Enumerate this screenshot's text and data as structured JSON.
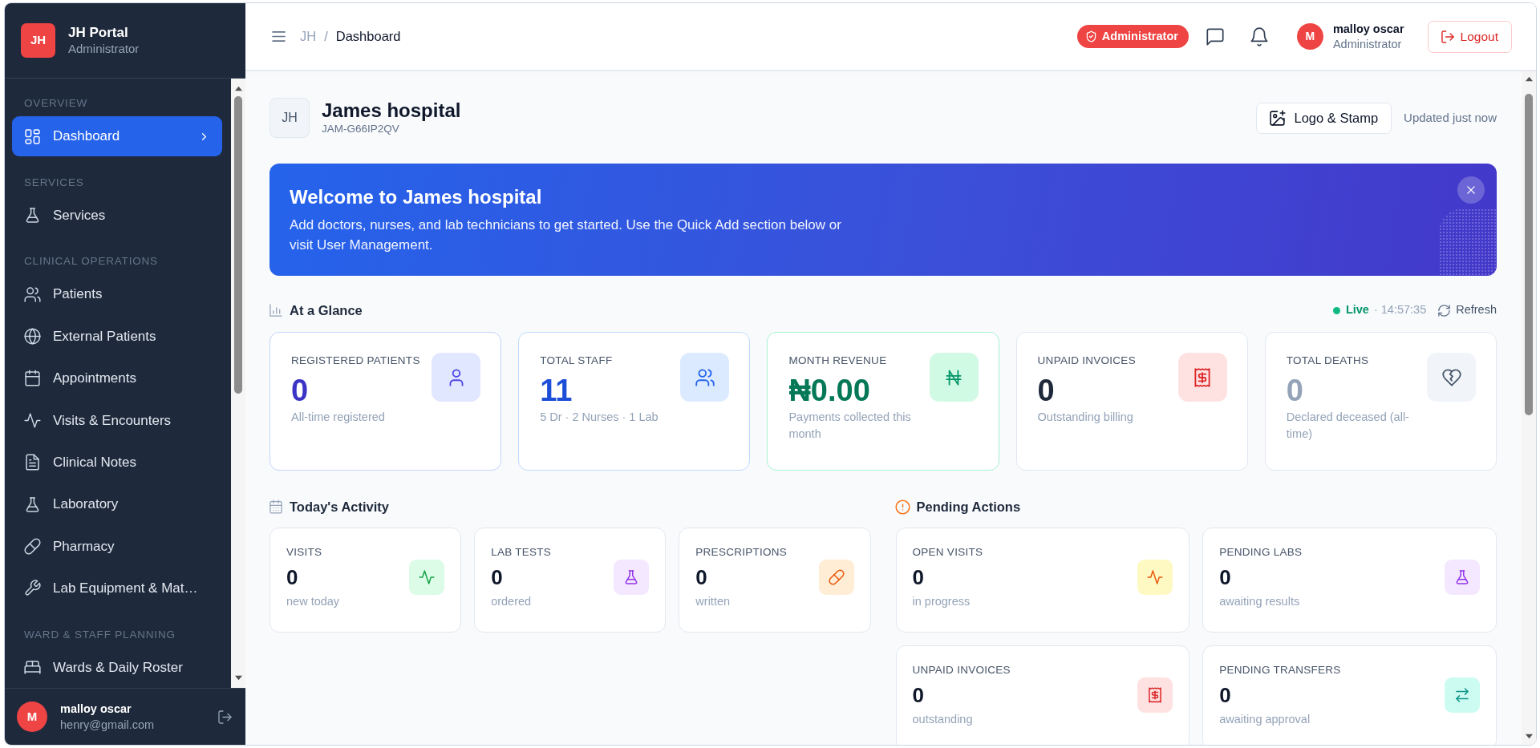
{
  "sidebar": {
    "brand": {
      "logo": "JH",
      "title": "JH Portal",
      "subtitle": "Administrator"
    },
    "sections": [
      {
        "heading": "OVERVIEW",
        "items": [
          {
            "label": "Dashboard",
            "kind": "dashboard",
            "selected": true
          }
        ]
      },
      {
        "heading": "SERVICES",
        "items": [
          {
            "label": "Services",
            "kind": "services",
            "selected": false
          }
        ]
      },
      {
        "heading": "CLINICAL OPERATIONS",
        "items": [
          {
            "label": "Patients",
            "kind": "patients",
            "selected": false
          },
          {
            "label": "External Patients",
            "kind": "external",
            "selected": false
          },
          {
            "label": "Appointments",
            "kind": "appointments",
            "selected": false
          },
          {
            "label": "Visits & Encounters",
            "kind": "visits",
            "selected": false
          },
          {
            "label": "Clinical Notes",
            "kind": "notes",
            "selected": false
          },
          {
            "label": "Laboratory",
            "kind": "lab",
            "selected": false
          },
          {
            "label": "Pharmacy",
            "kind": "pharmacy",
            "selected": false
          },
          {
            "label": "Lab Equipment & Mat…",
            "kind": "equipment",
            "selected": false
          }
        ]
      },
      {
        "heading": "WARD & STAFF PLANNING",
        "items": [
          {
            "label": "Wards & Daily Roster",
            "kind": "wards",
            "selected": false
          }
        ]
      }
    ],
    "user": {
      "avatar": "M",
      "name": "malloy oscar",
      "email": "henry@gmail.com"
    }
  },
  "topbar": {
    "breadcrumb": {
      "root": "JH",
      "separator": "/",
      "current": "Dashboard"
    },
    "role_badge": "Administrator",
    "user": {
      "avatar": "M",
      "name": "malloy oscar",
      "role": "Administrator"
    },
    "logout": "Logout"
  },
  "hospital": {
    "initials": "JH",
    "name": "James hospital",
    "code": "JAM-G66IP2QV",
    "logo_button": "Logo & Stamp",
    "updated": "Updated just now"
  },
  "banner": {
    "title": "Welcome to James hospital",
    "text": "Add doctors, nurses, and lab technicians to get started. Use the Quick Add section below or visit User Management."
  },
  "at_a_glance": {
    "title": "At a Glance",
    "status": "Live",
    "time": "· 14:57:35",
    "refresh": "Refresh",
    "cards": [
      {
        "kind": "patients",
        "label": "REGISTERED PATIENTS",
        "value": "0",
        "note": "All-time registered"
      },
      {
        "kind": "staff",
        "label": "TOTAL STAFF",
        "value": "11",
        "note": "5 Dr · 2 Nurses · 1 Lab"
      },
      {
        "kind": "revenue",
        "label": "MONTH REVENUE",
        "value": "₦0.00",
        "note": "Payments collected this month"
      },
      {
        "kind": "invoices",
        "label": "UNPAID INVOICES",
        "value": "0",
        "note": "Outstanding billing"
      },
      {
        "kind": "deaths",
        "label": "TOTAL DEATHS",
        "value": "0",
        "note": "Declared deceased (all-time)"
      }
    ]
  },
  "todays_activity": {
    "title": "Today's Activity",
    "cards": [
      {
        "kind": "visits",
        "label": "VISITS",
        "value": "0",
        "note": "new today"
      },
      {
        "kind": "lab",
        "label": "LAB TESTS",
        "value": "0",
        "note": "ordered"
      },
      {
        "kind": "prescriptions",
        "label": "PRESCRIPTIONS",
        "value": "0",
        "note": "written"
      }
    ]
  },
  "pending_actions": {
    "title": "Pending Actions",
    "cards": [
      {
        "kind": "open_visits",
        "label": "OPEN VISITS",
        "value": "0",
        "note": "in progress"
      },
      {
        "kind": "lab",
        "label": "PENDING LABS",
        "value": "0",
        "note": "awaiting results"
      },
      {
        "kind": "invoices",
        "label": "UNPAID INVOICES",
        "value": "0",
        "note": "outstanding"
      },
      {
        "kind": "transfers",
        "label": "PENDING TRANSFERS",
        "value": "0",
        "note": "awaiting approval"
      }
    ]
  }
}
